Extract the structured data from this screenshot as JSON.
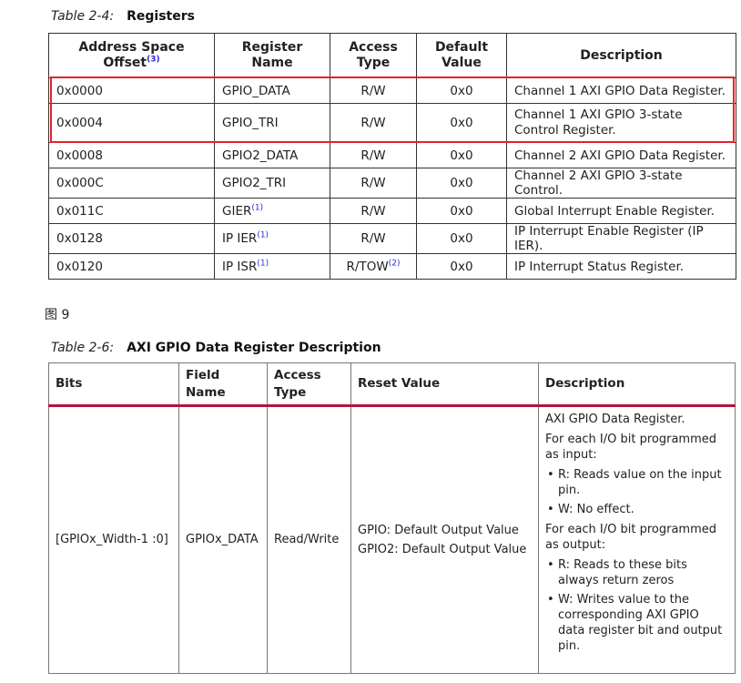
{
  "table1": {
    "caption_num": "Table 2-4:",
    "caption_title": "Registers",
    "headers": {
      "offset": "Address Space Offset",
      "offset_ref": "(3)",
      "name": "Register Name",
      "access": "Access Type",
      "default": "Default Value",
      "description": "Description"
    },
    "rows": [
      {
        "offset": "0x0000",
        "name": "GPIO_DATA",
        "name_ref": "",
        "access": "R/W",
        "access_ref": "",
        "default": "0x0",
        "description": "Channel 1 AXI GPIO Data Register.",
        "highlighted": true
      },
      {
        "offset": "0x0004",
        "name": "GPIO_TRI",
        "name_ref": "",
        "access": "R/W",
        "access_ref": "",
        "default": "0x0",
        "description": "Channel 1 AXI GPIO 3-state Control Register.",
        "highlighted": true
      },
      {
        "offset": "0x0008",
        "name": "GPIO2_DATA",
        "name_ref": "",
        "access": "R/W",
        "access_ref": "",
        "default": "0x0",
        "description": "Channel 2 AXI GPIO Data Register."
      },
      {
        "offset": "0x000C",
        "name": "GPIO2_TRI",
        "name_ref": "",
        "access": "R/W",
        "access_ref": "",
        "default": "0x0",
        "description": "Channel 2 AXI GPIO 3-state Control."
      },
      {
        "offset": "0x011C",
        "name": "GIER",
        "name_ref": "(1)",
        "access": "R/W",
        "access_ref": "",
        "default": "0x0",
        "description": "Global Interrupt Enable Register."
      },
      {
        "offset": "0x0128",
        "name": "IP IER",
        "name_ref": "(1)",
        "access": "R/W",
        "access_ref": "",
        "default": "0x0",
        "description": "IP Interrupt Enable Register (IP IER)."
      },
      {
        "offset": "0x0120",
        "name": "IP ISR",
        "name_ref": "(1)",
        "access": "R/TOW",
        "access_ref": "(2)",
        "default": "0x0",
        "description": "IP Interrupt Status Register."
      }
    ],
    "highlight_color": "#e5222c"
  },
  "figure_label": "图 9",
  "table2": {
    "caption_num": "Table 2-6:",
    "caption_title": "AXI GPIO Data Register Description",
    "headers": {
      "bits": "Bits",
      "field": "Field Name",
      "access": "Access Type",
      "reset": "Reset Value",
      "description": "Description"
    },
    "row": {
      "bits": "[GPIOx_Width-1 :0]",
      "field": "GPIOx_DATA",
      "access": "Read/Write",
      "reset": [
        "GPIO: Default Output Value",
        "GPIO2: Default Output Value"
      ],
      "description": {
        "intro": "AXI GPIO Data Register.",
        "input_heading": "For each I/O bit programmed as input:",
        "input_items": [
          "R: Reads value on the input pin.",
          "W: No effect."
        ],
        "output_heading": "For each I/O bit programmed as output:",
        "output_items": [
          "R: Reads to these bits always return zeros",
          "W: Writes value to the corresponding AXI GPIO data register bit and output pin."
        ]
      }
    },
    "header_rule_color": "#b5123e"
  }
}
